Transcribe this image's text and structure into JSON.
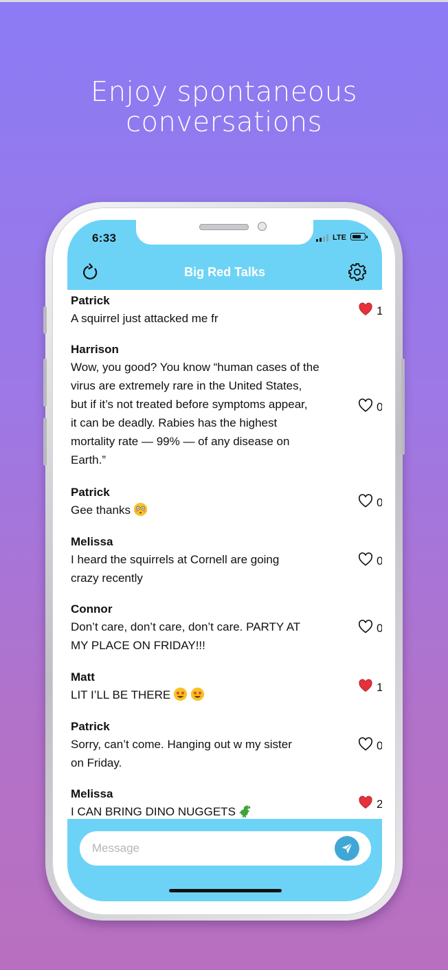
{
  "headline": {
    "line1": "Enjoy spontaneous",
    "line2": "conversations"
  },
  "status_bar": {
    "time": "6:33",
    "network": "LTE"
  },
  "header": {
    "title": "Big Red Talks",
    "left_icon": "refresh-icon",
    "right_icon": "gear-icon"
  },
  "messages": [
    {
      "name": "Patrick",
      "lines": [
        "A squirrel just attacked me fr"
      ],
      "likes": "1",
      "liked": true
    },
    {
      "name": "Harrison",
      "lines": [
        "Wow, you good? You know “human cases of the",
        "virus are extremely rare in the United States,",
        "but if it’s not treated before symptoms appear,",
        "it can be deadly. Rabies has the highest",
        "mortality rate — 99% — of any disease on",
        "Earth.”"
      ],
      "likes": "0",
      "liked": false
    },
    {
      "name": "Patrick",
      "lines": [
        "Gee thanks"
      ],
      "emoji": [
        "flushed-face"
      ],
      "likes": "0",
      "liked": false
    },
    {
      "name": "Melissa",
      "lines": [
        "I heard the squirrels at Cornell are going",
        "crazy recently"
      ],
      "likes": "0",
      "liked": false
    },
    {
      "name": "Connor",
      "lines": [
        "Don’t care, don’t care, don’t care. PARTY AT",
        "MY PLACE ON FRIDAY!!!"
      ],
      "likes": "0",
      "liked": false
    },
    {
      "name": "Matt",
      "lines": [
        "LIT I’LL BE THERE"
      ],
      "emoji": [
        "star-struck",
        "star-struck"
      ],
      "likes": "1",
      "liked": true
    },
    {
      "name": "Patrick",
      "lines": [
        "Sorry, can’t come. Hanging out w my sister",
        "on Friday."
      ],
      "likes": "0",
      "liked": false
    },
    {
      "name": "Melissa",
      "lines": [
        "I CAN BRING DINO NUGGETS"
      ],
      "emoji": [
        "t-rex"
      ],
      "likes": "2",
      "liked": true
    }
  ],
  "composer": {
    "placeholder": "Message",
    "send_icon": "send-icon"
  },
  "colors": {
    "accent": "#6dd3f6",
    "send_button": "#3fa7d6",
    "liked_heart": "#e8303a",
    "background_top": "#8b7bf4",
    "background_bottom": "#b96fbf"
  }
}
